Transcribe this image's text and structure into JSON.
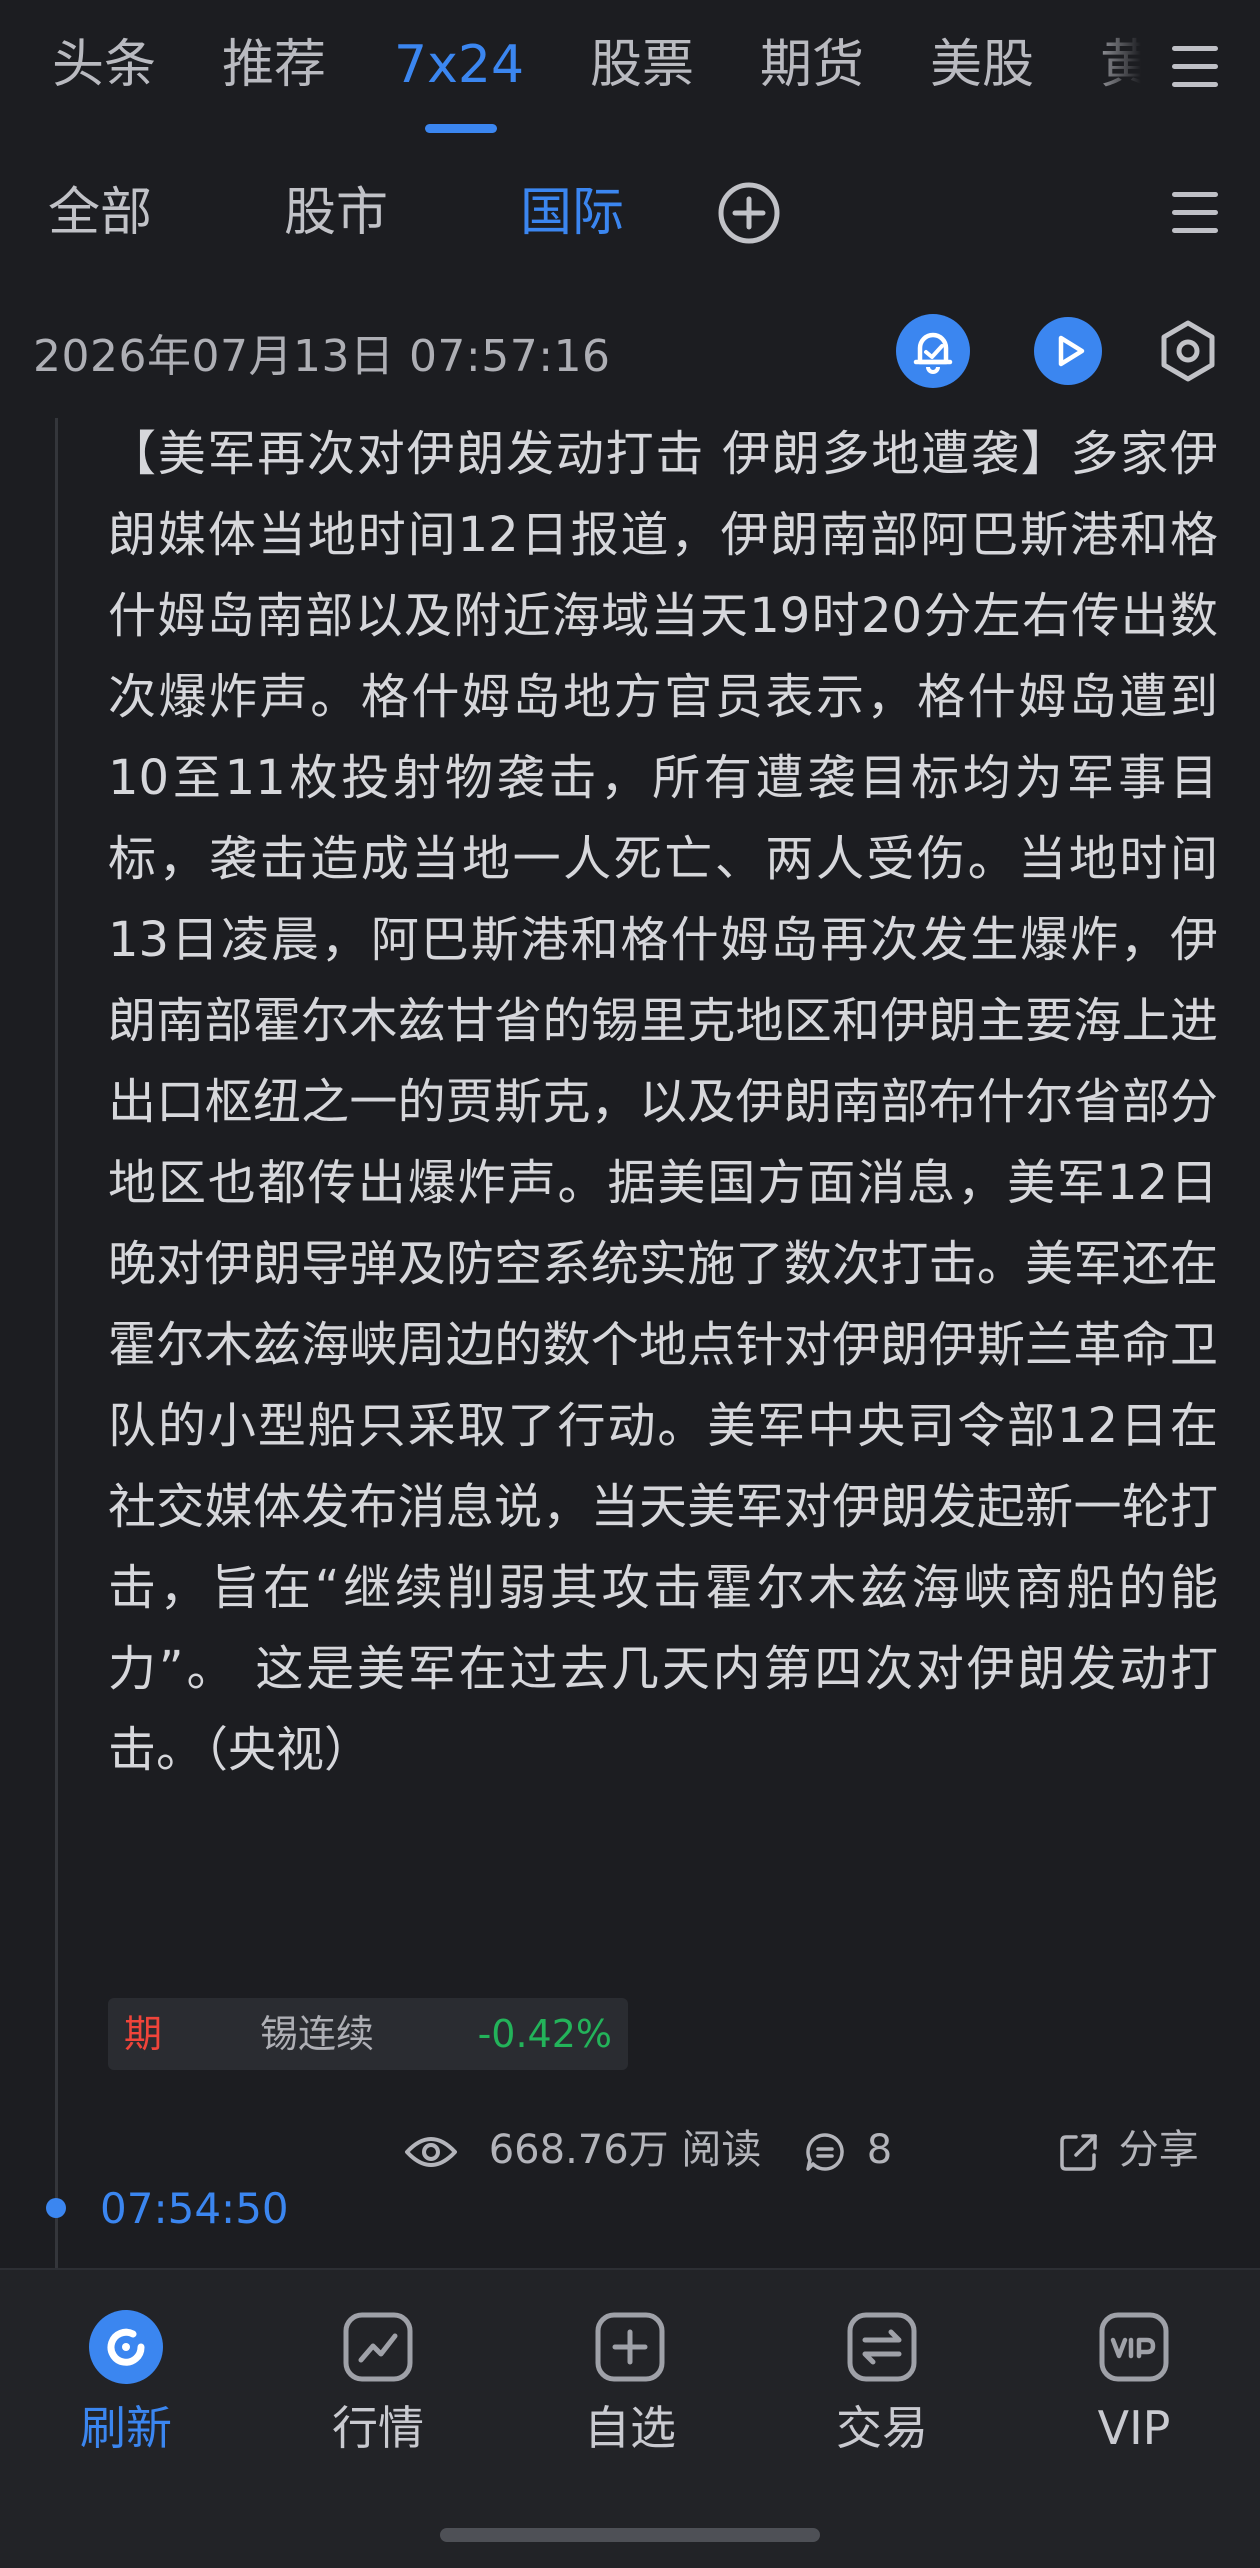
{
  "top_tabs": [
    {
      "label": "头条"
    },
    {
      "label": "推荐"
    },
    {
      "label": "7x24"
    },
    {
      "label": "股票"
    },
    {
      "label": "期货"
    },
    {
      "label": "美股"
    },
    {
      "label": "黄"
    }
  ],
  "active_top_tab": "7x24",
  "sub_tabs": [
    {
      "label": "全部"
    },
    {
      "label": "股市"
    },
    {
      "label": "国际"
    }
  ],
  "active_sub_tab": "国际",
  "item": {
    "timestamp": "2026年07月13日 07:57:16",
    "body": "【美军再次对伊朗发动打击 伊朗多地遭袭】多家伊朗媒体当地时间12日报道，伊朗南部阿巴斯港和格什姆岛南部以及附近海域当天19时20分左右传出数次爆炸声。格什姆岛地方官员表示，格什姆岛遭到10至11枚投射物袭击，所有遭袭目标均为军事目标，袭击造成当地一人死亡、两人受伤。当地时间13日凌晨，阿巴斯港和格什姆岛再次发生爆炸，伊朗南部霍尔木兹甘省的锡里克地区和伊朗主要海上进出口枢纽之一的贾斯克，以及伊朗南部布什尔省部分地区也都传出爆炸声。据美国方面消息，美军12日晚对伊朗导弹及防空系统实施了数次打击。美军还在霍尔木兹海峡周边的数个地点针对伊朗伊斯兰革命卫队的小型船只采取了行动。美军中央司令部12日在社交媒体发布消息说，当天美军对伊朗发起新一轮打击，旨在“继续削弱其攻击霍尔木兹海峡商船的能力”。 这是美军在过去几天内第四次对伊朗发动打击。（央视）",
    "stock": {
      "tag": "期",
      "name": "锡连续",
      "change": "-0.42%"
    },
    "views": "668.76万 阅读",
    "comments": "8",
    "share_label": "分享"
  },
  "next_item_time": "07:54:50",
  "bottom_nav": [
    {
      "label": "刷新",
      "icon": "refresh-icon"
    },
    {
      "label": "行情",
      "icon": "market-chart-icon"
    },
    {
      "label": "自选",
      "icon": "add-watchlist-icon"
    },
    {
      "label": "交易",
      "icon": "trade-exchange-icon"
    },
    {
      "label": "VIP",
      "icon": "vip-icon"
    }
  ],
  "active_bottom_nav": "刷新",
  "colors": {
    "accent": "#3b86f0",
    "background": "#1c1d21",
    "rise": "#f0443a",
    "fall": "#23b35a"
  }
}
